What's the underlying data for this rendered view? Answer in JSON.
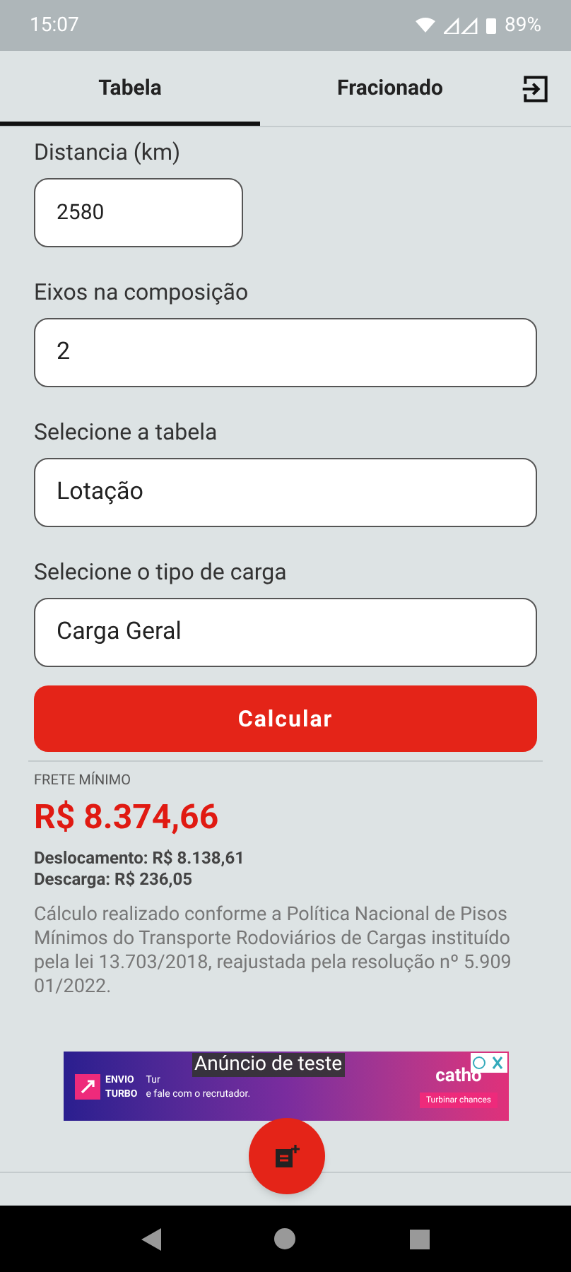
{
  "status_bar": {
    "time": "15:07",
    "battery": "89%"
  },
  "tabs": [
    {
      "label": "Tabela",
      "selected": true
    },
    {
      "label": "Fracionado",
      "selected": false
    }
  ],
  "form": {
    "fields": [
      {
        "label": "Distancia (km)",
        "value": "2580",
        "kind": "short"
      },
      {
        "label": "Eixos na composição",
        "value": "2",
        "kind": "full"
      },
      {
        "label": "Selecione a tabela",
        "value": "Lotação",
        "kind": "full"
      },
      {
        "label": "Selecione o tipo de carga",
        "value": "Carga Geral",
        "kind": "full"
      }
    ],
    "button": "Calcular"
  },
  "result": {
    "caption": "FRETE MÍNIMO",
    "total": "R$ 8.374,66",
    "lines": [
      "Deslocamento: R$ 8.138,61",
      "Descarga: R$ 236,05"
    ],
    "note": "Cálculo realizado conforme a Política Nacional de Pisos Mínimos do Transporte Rodoviários de Cargas instituído pela lei 13.703/2018, reajustada pela resolução nº 5.909 01/2022."
  },
  "ad": {
    "label": "Anúncio de teste",
    "brand_line_1": "ENVIO",
    "brand_line_2": "TURBO",
    "text_1": "Tur",
    "text_2": "e fale com o recrutador.",
    "logo": "catho",
    "cta": "Turbinar chances"
  }
}
